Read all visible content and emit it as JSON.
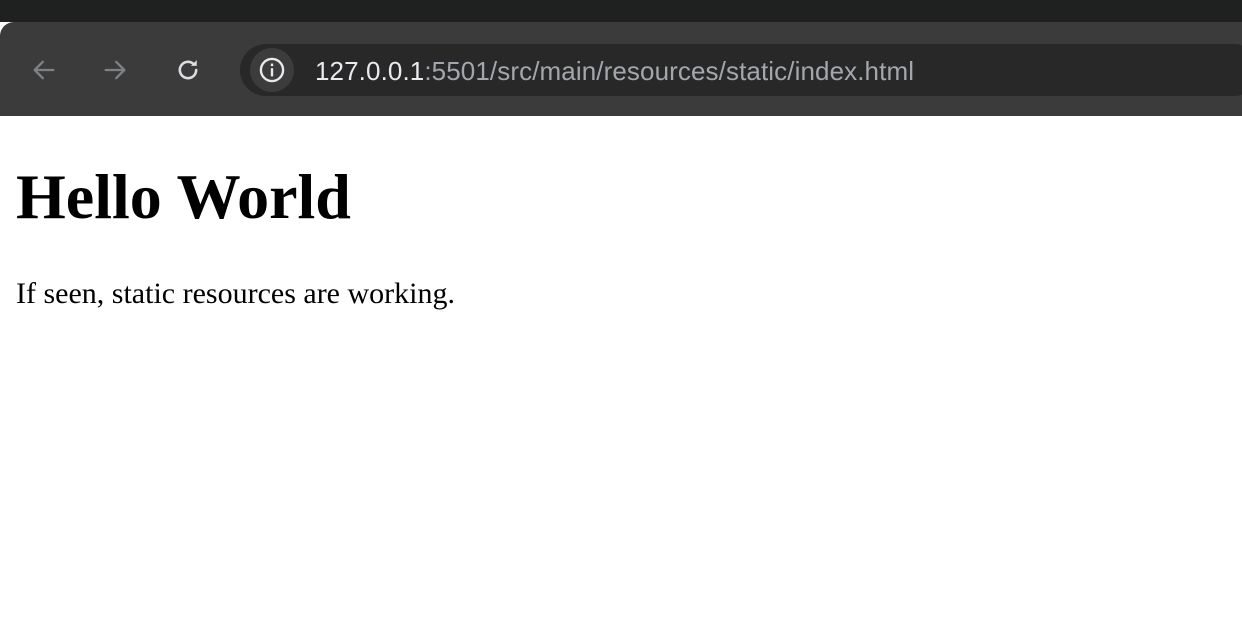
{
  "browser": {
    "toolbar": {
      "back": {
        "icon": "arrow-left-icon",
        "enabled": false
      },
      "forward": {
        "icon": "arrow-right-icon",
        "enabled": false
      },
      "reload": {
        "icon": "reload-icon"
      }
    },
    "address_bar": {
      "site_info_icon": "info-icon",
      "url_host": "127.0.0.1",
      "url_rest": ":5501/src/main/resources/static/index.html"
    },
    "colors": {
      "tabstrip": "#1f2020",
      "toolbar": "#3b3b3b",
      "omnibox": "#282828",
      "url_host": "#e8eaed",
      "url_rest": "#a3a7ad",
      "icon_disabled": "#7e8185",
      "icon_enabled": "#dcdde0"
    }
  },
  "page": {
    "heading": "Hello World",
    "paragraph": "If seen, static resources are working."
  }
}
